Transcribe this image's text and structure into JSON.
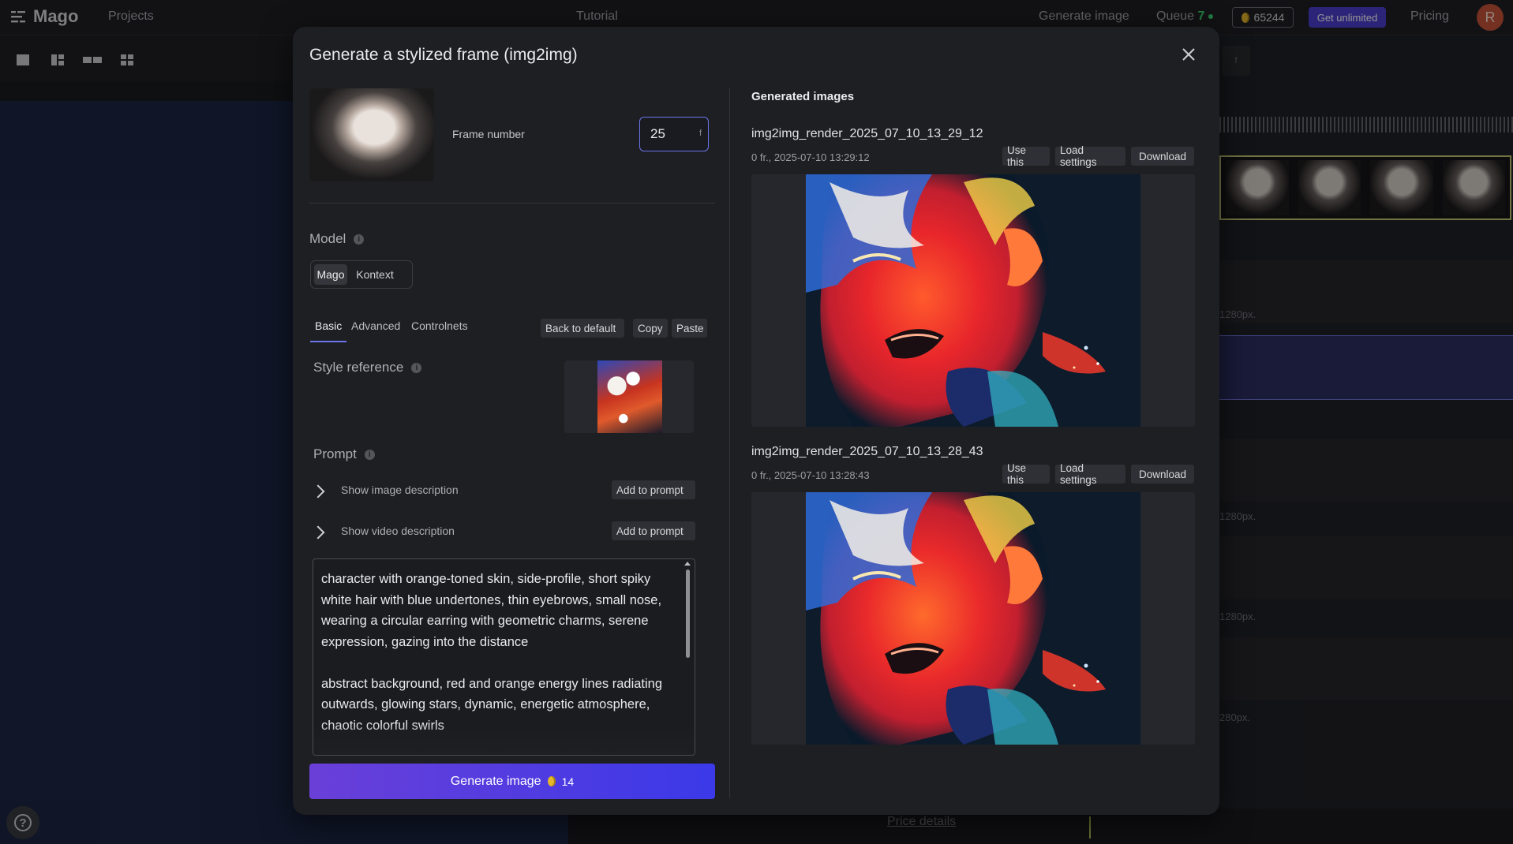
{
  "topbar": {
    "brand": "Mago",
    "projects": "Projects",
    "tutorial": "Tutorial",
    "generate_image": "Generate image",
    "queue_label": "Queue",
    "queue_count": "7",
    "credits": "65244",
    "get_unlimited": "Get unlimited",
    "pricing": "Pricing",
    "avatar_initial": "R"
  },
  "background": {
    "price_details": "Price details",
    "right_chip": "f",
    "px_labels": [
      "1280px.",
      "1280px.",
      "1280px.",
      "280px."
    ]
  },
  "modal": {
    "title": "Generate a stylized frame (img2img)",
    "frame_label": "Frame number",
    "frame_value": "25",
    "frame_unit": "f",
    "model_label": "Model",
    "model_options": [
      "Mago",
      "Kontext"
    ],
    "model_selected": "Mago",
    "tabs": [
      "Basic",
      "Advanced",
      "Controlnets"
    ],
    "active_tab": "Basic",
    "back_to_default": "Back to default",
    "copy": "Copy",
    "paste": "Paste",
    "style_reference_label": "Style reference",
    "prompt_label": "Prompt",
    "show_image_description": "Show image description",
    "show_video_description": "Show video description",
    "add_to_prompt": "Add to prompt",
    "prompt_text": "character with orange-toned skin, side-profile, short spiky white hair with blue undertones, thin eyebrows, small nose, wearing a circular earring with geometric charms, serene expression, gazing into the distance\n\nabstract background, red and orange energy lines radiating outwards, glowing stars, dynamic, energetic atmosphere, chaotic colorful swirls\n\nexpressive digital painting, textured brushstrokes, vibrant",
    "generate_button": "Generate image",
    "generate_cost": "14"
  },
  "generated": {
    "heading": "Generated images",
    "items": [
      {
        "title": "img2img_render_2025_07_10_13_29_12",
        "meta": "0 fr., 2025-07-10 13:29:12",
        "use_this": "Use this",
        "load_settings": "Load settings",
        "download": "Download"
      },
      {
        "title": "img2img_render_2025_07_10_13_28_43",
        "meta": "0 fr., 2025-07-10 13:28:43",
        "use_this": "Use this",
        "load_settings": "Load settings",
        "download": "Download"
      }
    ]
  },
  "colors": {
    "accent": "#6a75e8",
    "brand_purple": "#4b3fcf",
    "queue_green": "#3bd16f",
    "coin_gold": "#e5b72b"
  }
}
